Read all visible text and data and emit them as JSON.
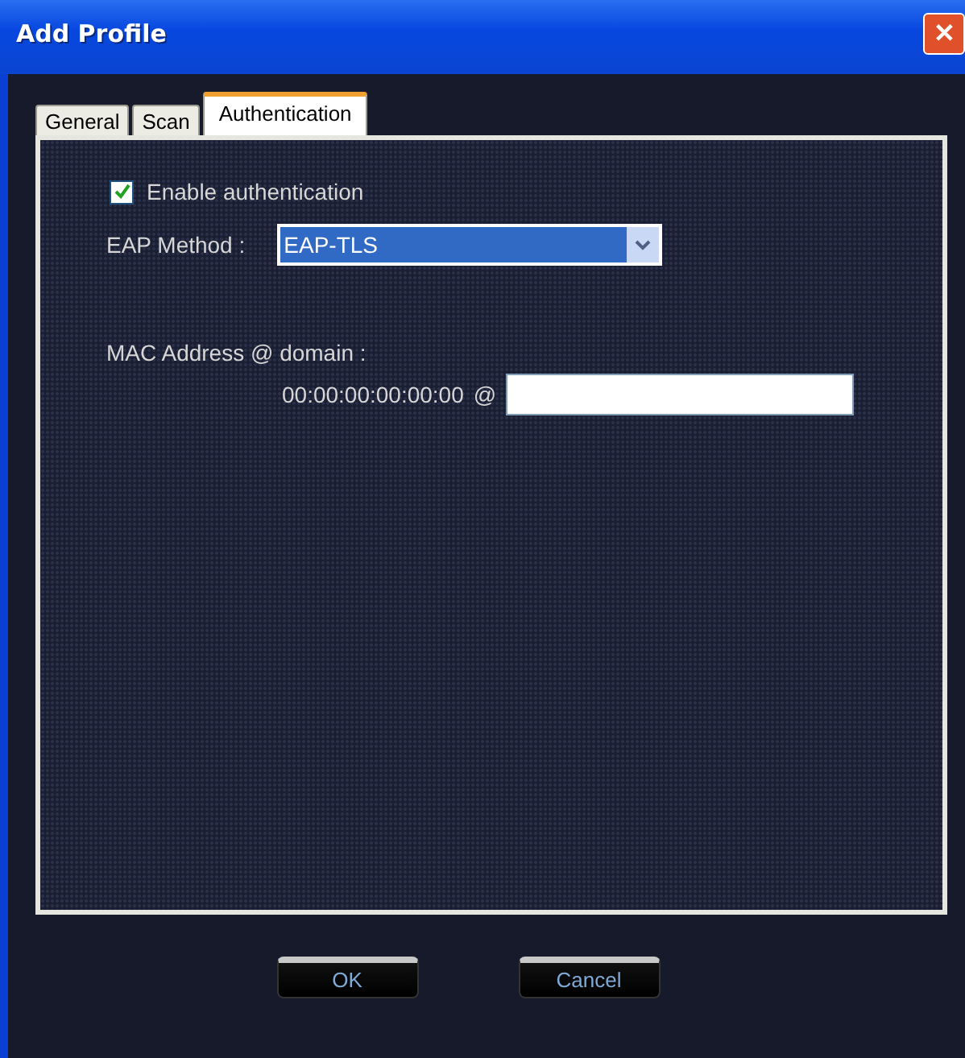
{
  "window": {
    "title": "Add Profile",
    "close": "✕"
  },
  "tabs": [
    {
      "label": "General",
      "selected": false
    },
    {
      "label": "Scan",
      "selected": false
    },
    {
      "label": "Authentication",
      "selected": true
    }
  ],
  "enable_authentication": {
    "label": "Enable authentication",
    "checked": true
  },
  "eap_method": {
    "label": "EAP Method :",
    "value": "EAP-TLS"
  },
  "mac_address": {
    "label": "MAC Address @ domain :",
    "value": "00:00:00:00:00:00",
    "separator": "@"
  },
  "buttons": [
    "OK",
    "Cancel"
  ]
}
